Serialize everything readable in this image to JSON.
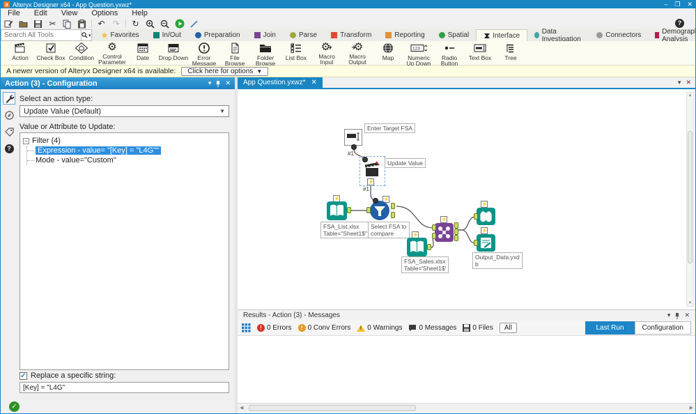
{
  "window": {
    "title": "Alteryx Designer x64 - App Question.yxwz*",
    "logo": "a",
    "minimize": "–",
    "restore": "❐",
    "close": "✕"
  },
  "menu": {
    "items": [
      {
        "label": "File"
      },
      {
        "label": "Edit"
      },
      {
        "label": "View"
      },
      {
        "label": "Options"
      },
      {
        "label": "Help"
      }
    ]
  },
  "search": {
    "placeholder": "Search All Tools"
  },
  "palette_tabs": [
    {
      "label": "Favorites",
      "color": "#f0c04a"
    },
    {
      "label": "In/Out",
      "color": "#0e8476"
    },
    {
      "label": "Preparation",
      "color": "#2062a8"
    },
    {
      "label": "Join",
      "color": "#7a4393"
    },
    {
      "label": "Parse",
      "color": "#a2a838"
    },
    {
      "label": "Transform",
      "color": "#e2492f"
    },
    {
      "label": "Reporting",
      "color": "#e0913c"
    },
    {
      "label": "Spatial",
      "color": "#2f9e48"
    },
    {
      "label": "Interface",
      "color": "#222222",
      "active": true
    },
    {
      "label": "Data Investigation",
      "color": "#41a6a0"
    },
    {
      "label": "Connectors",
      "color": "#9a9a9a"
    },
    {
      "label": "Demographic Analysis",
      "color": "#b01c4b"
    },
    {
      "label": "+"
    }
  ],
  "tools": [
    {
      "label": "Action"
    },
    {
      "label": "Check Box"
    },
    {
      "label": "Condition"
    },
    {
      "label": "Control Parameter"
    },
    {
      "label": "Date"
    },
    {
      "label": "Drop Down"
    },
    {
      "label": "Error Message"
    },
    {
      "label": "File Browse"
    },
    {
      "label": "Folder Browse"
    },
    {
      "label": "List Box"
    },
    {
      "label": "Macro Input"
    },
    {
      "label": "Macro Output"
    },
    {
      "label": "Map"
    },
    {
      "label": "Numeric Up Down"
    },
    {
      "label": "Radio Button"
    },
    {
      "label": "Text Box"
    },
    {
      "label": "Tree"
    }
  ],
  "banner": {
    "text": "A newer version of Alteryx Designer x64 is available:",
    "button": "Click here for options",
    "caret": "▼"
  },
  "config": {
    "title": "Action (3) - Configuration",
    "action_type_label": "Select an action type:",
    "action_type_value": "Update Value (Default)",
    "value_label": "Value or Attribute to Update:",
    "tree": {
      "root": "Filter (4)",
      "child_selected": "Expression - value= \"[Key] = \"L4G\"\"",
      "child2": "Mode - value=\"Custom\""
    },
    "replace_label": "Replace a specific string:",
    "replace_value": "[Key] = \"L4G\""
  },
  "canvas": {
    "tab": "App Question.yxwz*",
    "labels": {
      "textbox": "Enter Target FSA",
      "action": "Update Value",
      "input1_line1": "FSA_List.xlsx",
      "input1_line2": "Table=\"Sheet1$\"",
      "filter_line1": "Select FSA to",
      "filter_line2": "compare",
      "input2_line1": "FSA_Sales.xlsx",
      "input2_line2": "Table='Sheet1$'",
      "output_line1": "Output_Data.yxd",
      "output_line2": "b"
    },
    "conn1": "#1",
    "conn2": "#1"
  },
  "results": {
    "title": "Results - Action (3) - Messages",
    "errors": "0 Errors",
    "conv_errors": "0 Conv Errors",
    "warnings": "0 Warnings",
    "messages": "0 Messages",
    "files": "0 Files",
    "filter_all": "All",
    "last_run": "Last Run",
    "configuration": "Configuration",
    "colors": {
      "error": "#d93025",
      "conv": "#e8971e",
      "warning": "#f2c230"
    }
  }
}
